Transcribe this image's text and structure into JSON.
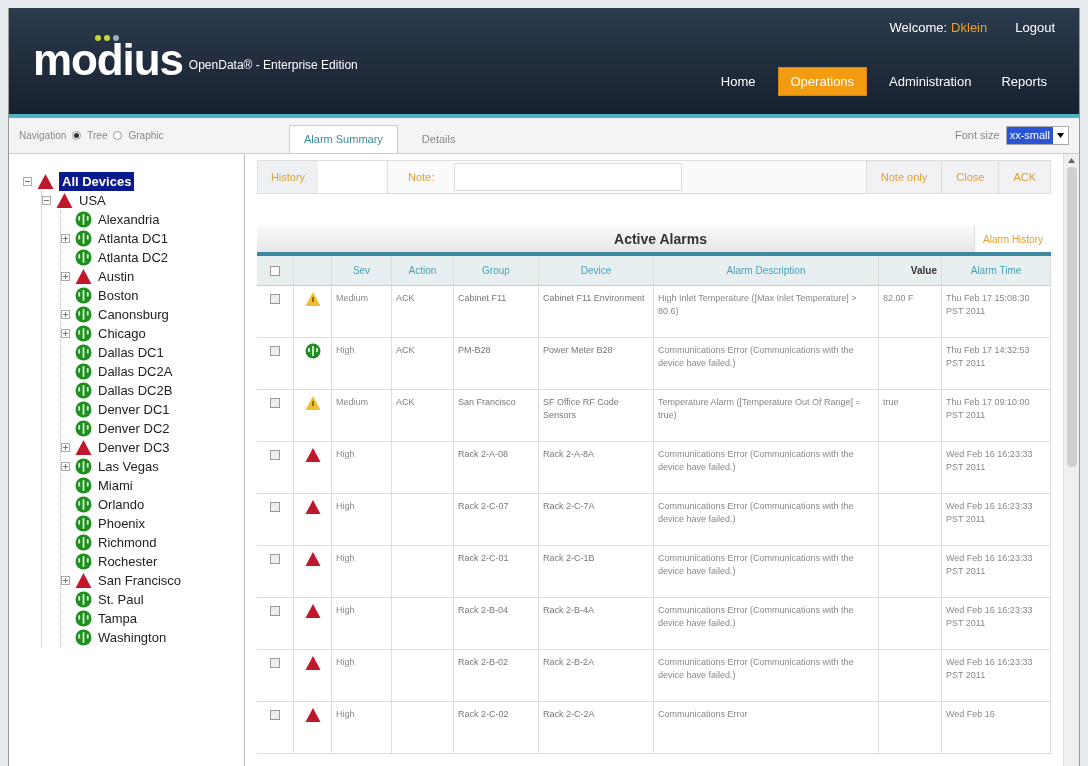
{
  "header": {
    "logo": "modius",
    "edition": "OpenData® - Enterprise Edition",
    "welcome_label": "Welcome:",
    "user": "Dklein",
    "logout": "Logout",
    "nav": [
      {
        "label": "Home",
        "selected": false
      },
      {
        "label": "Operations",
        "selected": true
      },
      {
        "label": "Administration",
        "selected": false
      },
      {
        "label": "Reports",
        "selected": false
      }
    ]
  },
  "navigation": {
    "label": "Navigation",
    "options": [
      {
        "label": "Tree",
        "selected": true
      },
      {
        "label": "Graphic",
        "selected": false
      }
    ]
  },
  "tabs": [
    {
      "label": "Alarm Summary",
      "selected": true
    },
    {
      "label": "Details",
      "selected": false
    }
  ],
  "font_size": {
    "label": "Font size",
    "value": "xx-small"
  },
  "tree": [
    {
      "label": "All Devices",
      "kind": "critical",
      "expanded": true,
      "selected": true,
      "children": [
        {
          "label": "USA",
          "kind": "critical",
          "expanded": true,
          "selected": false,
          "children": [
            {
              "label": "Alexandria",
              "kind": "ok",
              "selected": false
            },
            {
              "label": "Atlanta DC1",
              "kind": "ok",
              "expanded": false,
              "selected": false
            },
            {
              "label": "Atlanta DC2",
              "kind": "ok",
              "selected": false
            },
            {
              "label": "Austin",
              "kind": "critical",
              "expanded": false,
              "selected": false
            },
            {
              "label": "Boston",
              "kind": "ok",
              "selected": false
            },
            {
              "label": "Canonsburg",
              "kind": "ok",
              "expanded": false,
              "selected": false
            },
            {
              "label": "Chicago",
              "kind": "ok",
              "expanded": false,
              "selected": false
            },
            {
              "label": "Dallas DC1",
              "kind": "ok",
              "selected": false
            },
            {
              "label": "Dallas DC2A",
              "kind": "ok",
              "selected": false
            },
            {
              "label": "Dallas DC2B",
              "kind": "ok",
              "selected": false
            },
            {
              "label": "Denver DC1",
              "kind": "ok",
              "selected": false
            },
            {
              "label": "Denver DC2",
              "kind": "ok",
              "selected": false
            },
            {
              "label": "Denver DC3",
              "kind": "critical",
              "expanded": false,
              "selected": false
            },
            {
              "label": "Las Vegas",
              "kind": "ok",
              "expanded": false,
              "selected": false
            },
            {
              "label": "Miami",
              "kind": "ok",
              "selected": false
            },
            {
              "label": "Orlando",
              "kind": "ok",
              "selected": false
            },
            {
              "label": "Phoenix",
              "kind": "ok",
              "selected": false
            },
            {
              "label": "Richmond",
              "kind": "ok",
              "selected": false
            },
            {
              "label": "Rochester",
              "kind": "ok",
              "selected": false
            },
            {
              "label": "San Francisco",
              "kind": "critical",
              "expanded": false,
              "selected": false
            },
            {
              "label": "St. Paul",
              "kind": "ok",
              "selected": false
            },
            {
              "label": "Tampa",
              "kind": "ok",
              "selected": false
            },
            {
              "label": "Washington",
              "kind": "ok",
              "selected": false
            }
          ]
        }
      ]
    }
  ],
  "toolbar": {
    "history": "History",
    "note_label": "Note:",
    "note_only": "Note only",
    "close": "Close",
    "ack": "ACK"
  },
  "alarms": {
    "title": "Active Alarms",
    "history_link": "Alarm History",
    "columns": [
      "Sev",
      "Action",
      "Group",
      "Device",
      "Alarm Description",
      "Value",
      "Alarm Time"
    ],
    "select_all_checked": false,
    "rows": [
      {
        "checked": false,
        "kind": "warning",
        "sev": "Medium",
        "action": "ACK",
        "group": "Cabinet F11",
        "device": "Cabinet F11 Environment",
        "description": "High Inlet Temperature ([Max Inlet Temperature] > 80.6)",
        "value": "82.00 F",
        "time": "Thu Feb 17 15:08:30 PST 2011"
      },
      {
        "checked": false,
        "kind": "ok",
        "sev": "High",
        "action": "ACK",
        "group": "PM-B28",
        "device": "Power Meter B28",
        "description": "Communications Error (Communications with the device have failed.)",
        "time": "Thu Feb 17 14:32:53 PST 2011"
      },
      {
        "checked": false,
        "kind": "warning",
        "sev": "Medium",
        "action": "ACK",
        "group": "San Francisco",
        "device": "SF Office RF Code Sensors",
        "description": "Temperature Alarm ([Temperature Out Of Range] = true)",
        "value": "true",
        "time": "Thu Feb 17 09:10:00 PST 2011"
      },
      {
        "checked": false,
        "kind": "critical",
        "sev": "High",
        "group": "Rack 2-A-08",
        "device": "Rack 2-A-8A",
        "description": "Communications Error (Communications with the device have failed.)",
        "time": "Wed Feb 16 16:23:33 PST 2011"
      },
      {
        "checked": false,
        "kind": "critical",
        "sev": "High",
        "group": "Rack 2-C-07",
        "device": "Rack 2-C-7A",
        "description": "Communications Error (Communications with the device have failed.)",
        "time": "Wed Feb 16 16:23:33 PST 2011"
      },
      {
        "checked": false,
        "kind": "critical",
        "sev": "High",
        "group": "Rack 2-C-01",
        "device": "Rack 2-C-1B",
        "description": "Communications Error (Communications with the device have failed.)",
        "time": "Wed Feb 16 16:23:33 PST 2011"
      },
      {
        "checked": false,
        "kind": "critical",
        "sev": "High",
        "group": "Rack 2-B-04",
        "device": "Rack 2-B-4A",
        "description": "Communications Error (Communications with the device have failed.)",
        "time": "Wed Feb 16 16:23:33 PST 2011"
      },
      {
        "checked": false,
        "kind": "critical",
        "sev": "High",
        "group": "Rack 2-B-02",
        "device": "Rack 2-B-2A",
        "description": "Communications Error (Communications with the device have failed.)",
        "time": "Wed Feb 16 16:23:33 PST 2011"
      },
      {
        "checked": false,
        "kind": "critical",
        "sev": "High",
        "group": "Rack 2-C-02",
        "device": "Rack 2-C-2A",
        "description": "Communications Error",
        "time": "Wed Feb 16"
      }
    ]
  }
}
